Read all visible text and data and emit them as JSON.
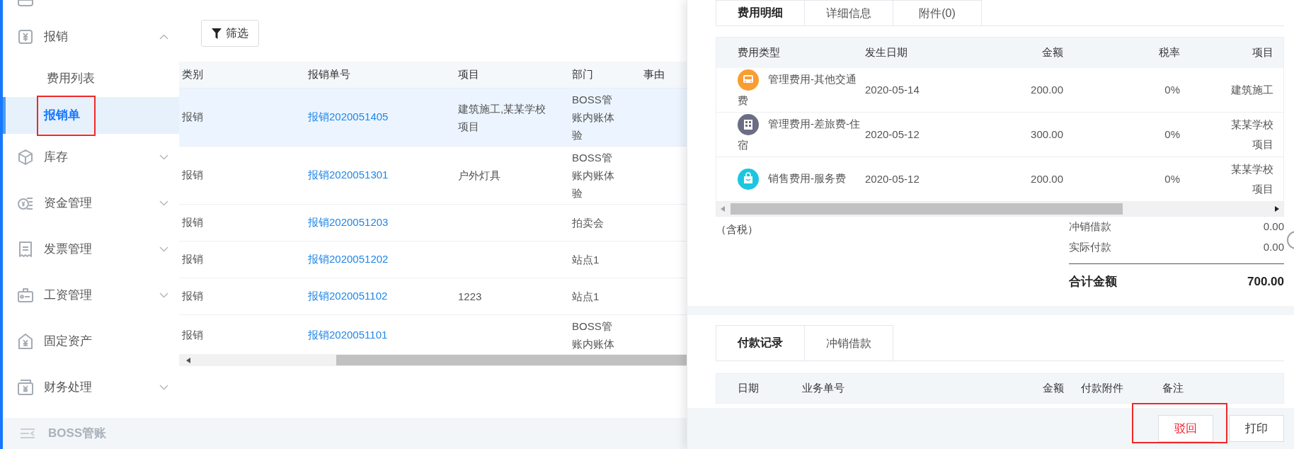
{
  "sidebar": {
    "items": [
      {
        "label": "报销",
        "kind": "group",
        "expanded": true,
        "children": [
          {
            "label": "费用列表",
            "selected": false,
            "highlighted": false
          },
          {
            "label": "报销单",
            "selected": true,
            "highlighted": true
          }
        ]
      },
      {
        "label": "库存",
        "kind": "group",
        "expanded": false
      },
      {
        "label": "资金管理",
        "kind": "group",
        "expanded": false
      },
      {
        "label": "发票管理",
        "kind": "group",
        "expanded": false
      },
      {
        "label": "工资管理",
        "kind": "group",
        "expanded": false
      },
      {
        "label": "固定资产",
        "kind": "link",
        "expanded": false
      },
      {
        "label": "财务处理",
        "kind": "group",
        "expanded": false
      }
    ],
    "collapse_label": "BOSS管账"
  },
  "toolbar": {
    "filter_button": "筛选"
  },
  "table": {
    "columns": [
      "类别",
      "报销单号",
      "项目",
      "部门",
      "事由"
    ],
    "rows": [
      {
        "category": "报销",
        "number": "报销2020051405",
        "project": "建筑施工,某某学校项目",
        "department": "BOSS管账内账体验",
        "selected": true
      },
      {
        "category": "报销",
        "number": "报销2020051301",
        "project": "户外灯具",
        "department": "BOSS管账内账体验",
        "selected": false
      },
      {
        "category": "报销",
        "number": "报销2020051203",
        "department": "拍卖会",
        "selected": false
      },
      {
        "category": "报销",
        "number": "报销2020051202",
        "department": "站点1",
        "selected": false
      },
      {
        "category": "报销",
        "number": "报销2020051102",
        "project": "1223",
        "department": "站点1",
        "selected": false
      },
      {
        "category": "报销",
        "number": "报销2020051101",
        "department": "BOSS管账内账体",
        "selected": false
      }
    ]
  },
  "detail": {
    "tabs": [
      {
        "label": "费用明细",
        "selected": true
      },
      {
        "label": "详细信息",
        "selected": false
      },
      {
        "label": "附件(0)",
        "selected": false
      }
    ],
    "expense_table": {
      "columns": [
        "费用类型",
        "发生日期",
        "金额",
        "税率",
        "项目"
      ],
      "rows": [
        {
          "type": "管理费用-其他交通费",
          "date": "2020-05-14",
          "amount": "200.00",
          "tax_rate": "0%",
          "project": "建筑施工",
          "color": "#f99d32"
        },
        {
          "type": "管理费用-差旅费-住宿",
          "date": "2020-05-12",
          "amount": "300.00",
          "tax_rate": "0%",
          "project": "某某学校项目",
          "color": "#6b6d82"
        },
        {
          "type": "销售费用-服务费",
          "date": "2020-05-12",
          "amount": "200.00",
          "tax_rate": "0%",
          "project": "某某学校项目",
          "color": "#1dc6e0"
        }
      ]
    },
    "tax_note": "（含税）",
    "summary": [
      {
        "label": "冲销借款",
        "value": "0.00",
        "kind": "line"
      },
      {
        "label": "实际付款",
        "value": "0.00",
        "kind": "line"
      },
      {
        "label": "合计金额",
        "value": "700.00",
        "kind": "total"
      }
    ],
    "record_tabs": [
      {
        "label": "付款记录",
        "selected": true
      },
      {
        "label": "冲销借款",
        "selected": false
      }
    ],
    "record_table": {
      "columns": [
        "日期",
        "业务单号",
        "金额",
        "付款附件",
        "备注"
      ]
    },
    "buttons": [
      {
        "label": "驳回",
        "kind": "danger",
        "highlighted": true
      },
      {
        "label": "打印",
        "kind": "default",
        "highlighted": false
      }
    ]
  }
}
